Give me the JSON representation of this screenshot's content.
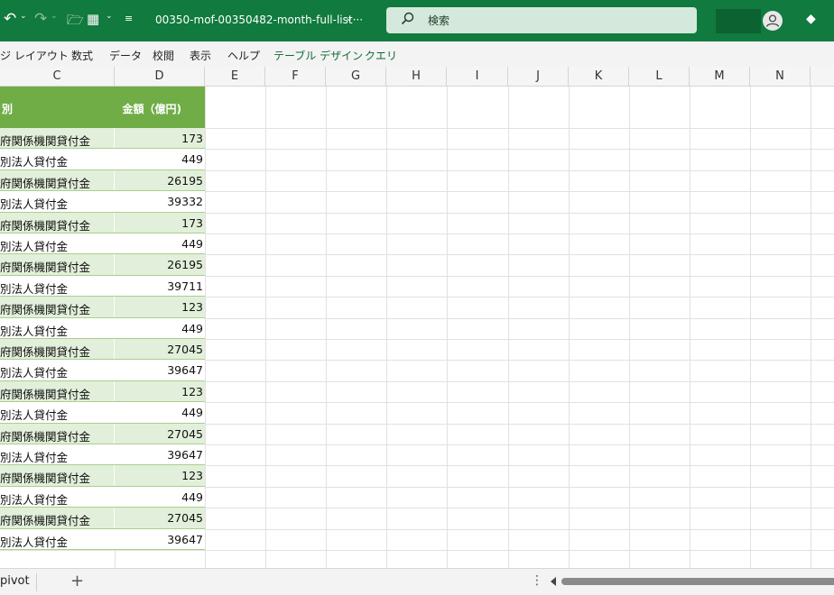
{
  "titlebar": {
    "undo_glyph": "↶",
    "redo_glyph": "↷",
    "chevron": "⌄",
    "folder_glyph": "🗁",
    "layout_glyph": "▦",
    "more_glyph": "≡",
    "filename": "00350-mof-00350482-month-full-list···",
    "search_placeholder": "検索",
    "diamond_glyph": "◆"
  },
  "menu": {
    "items": [
      "ジ レイアウト",
      "数式",
      "データ",
      "校閲",
      "表示",
      "ヘルプ"
    ],
    "contextual": [
      "テーブル デザイン",
      "クエリ"
    ]
  },
  "columns": [
    "C",
    "D",
    "E",
    "F",
    "G",
    "H",
    "I",
    "J",
    "K",
    "L",
    "M",
    "N"
  ],
  "table": {
    "header_c": "別",
    "header_d": "金額（億円)",
    "rows": [
      {
        "c": "府関係機関貸付金",
        "d": "173"
      },
      {
        "c": "別法人貸付金",
        "d": "449"
      },
      {
        "c": "府関係機関貸付金",
        "d": "26195"
      },
      {
        "c": "別法人貸付金",
        "d": "39332"
      },
      {
        "c": "府関係機関貸付金",
        "d": "173"
      },
      {
        "c": "別法人貸付金",
        "d": "449"
      },
      {
        "c": "府関係機関貸付金",
        "d": "26195"
      },
      {
        "c": "別法人貸付金",
        "d": "39711"
      },
      {
        "c": "府関係機関貸付金",
        "d": "123"
      },
      {
        "c": "別法人貸付金",
        "d": "449"
      },
      {
        "c": "府関係機関貸付金",
        "d": "27045"
      },
      {
        "c": "別法人貸付金",
        "d": "39647"
      },
      {
        "c": "府関係機関貸付金",
        "d": "123"
      },
      {
        "c": "別法人貸付金",
        "d": "449"
      },
      {
        "c": "府関係機関貸付金",
        "d": "27045"
      },
      {
        "c": "別法人貸付金",
        "d": "39647"
      },
      {
        "c": "府関係機関貸付金",
        "d": "123"
      },
      {
        "c": "別法人貸付金",
        "d": "449"
      },
      {
        "c": "府関係機関貸付金",
        "d": "27045"
      },
      {
        "c": "別法人貸付金",
        "d": "39647"
      }
    ]
  },
  "sheetbar": {
    "tab_label": "pivot",
    "add_label": "+",
    "dots": "⋮"
  },
  "colors": {
    "title_green": "#117a3e",
    "table_header": "#70ad47",
    "band": "#e2efda"
  }
}
